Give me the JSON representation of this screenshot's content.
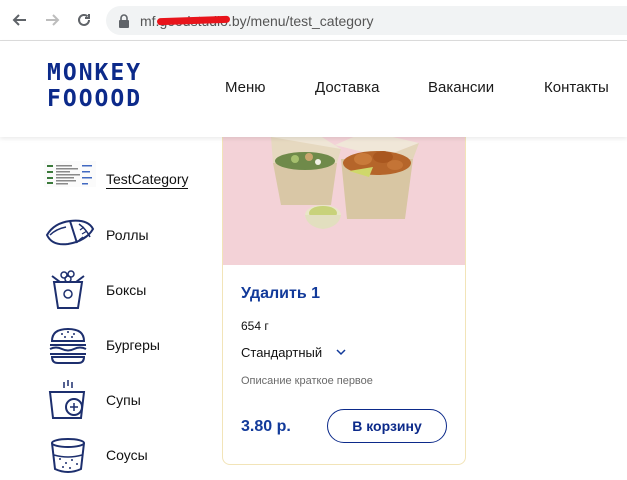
{
  "browser": {
    "url_prefix": "mf.",
    "url_hidden": "goodstudio",
    "url_suffix": ".by/menu/test_category"
  },
  "header": {
    "logo_line1": "MONKEY",
    "logo_line2": "FOOOOD",
    "nav": {
      "menu": "Меню",
      "delivery": "Доставка",
      "jobs": "Вакансии",
      "contacts": "Контакты"
    }
  },
  "sidebar": {
    "items": [
      {
        "label": "TestCategory",
        "icon": "test-category-thumbnail"
      },
      {
        "label": "Роллы",
        "icon": "rolls-icon"
      },
      {
        "label": "Боксы",
        "icon": "box-icon"
      },
      {
        "label": "Бургеры",
        "icon": "burger-icon"
      },
      {
        "label": "Супы",
        "icon": "soup-icon"
      },
      {
        "label": "Соусы",
        "icon": "sauce-icon"
      }
    ]
  },
  "product": {
    "title": "Удалить 1",
    "weight": "654 г",
    "variant": "Стандартный",
    "description": "Описание краткое первое",
    "price": "3.80 р.",
    "cart_label": "В корзину",
    "image": "food-boxes-photo"
  },
  "colors": {
    "brand_blue": "#0c2a8a",
    "card_image_bg": "#f3d2d7",
    "card_border": "#f2e4b8"
  }
}
